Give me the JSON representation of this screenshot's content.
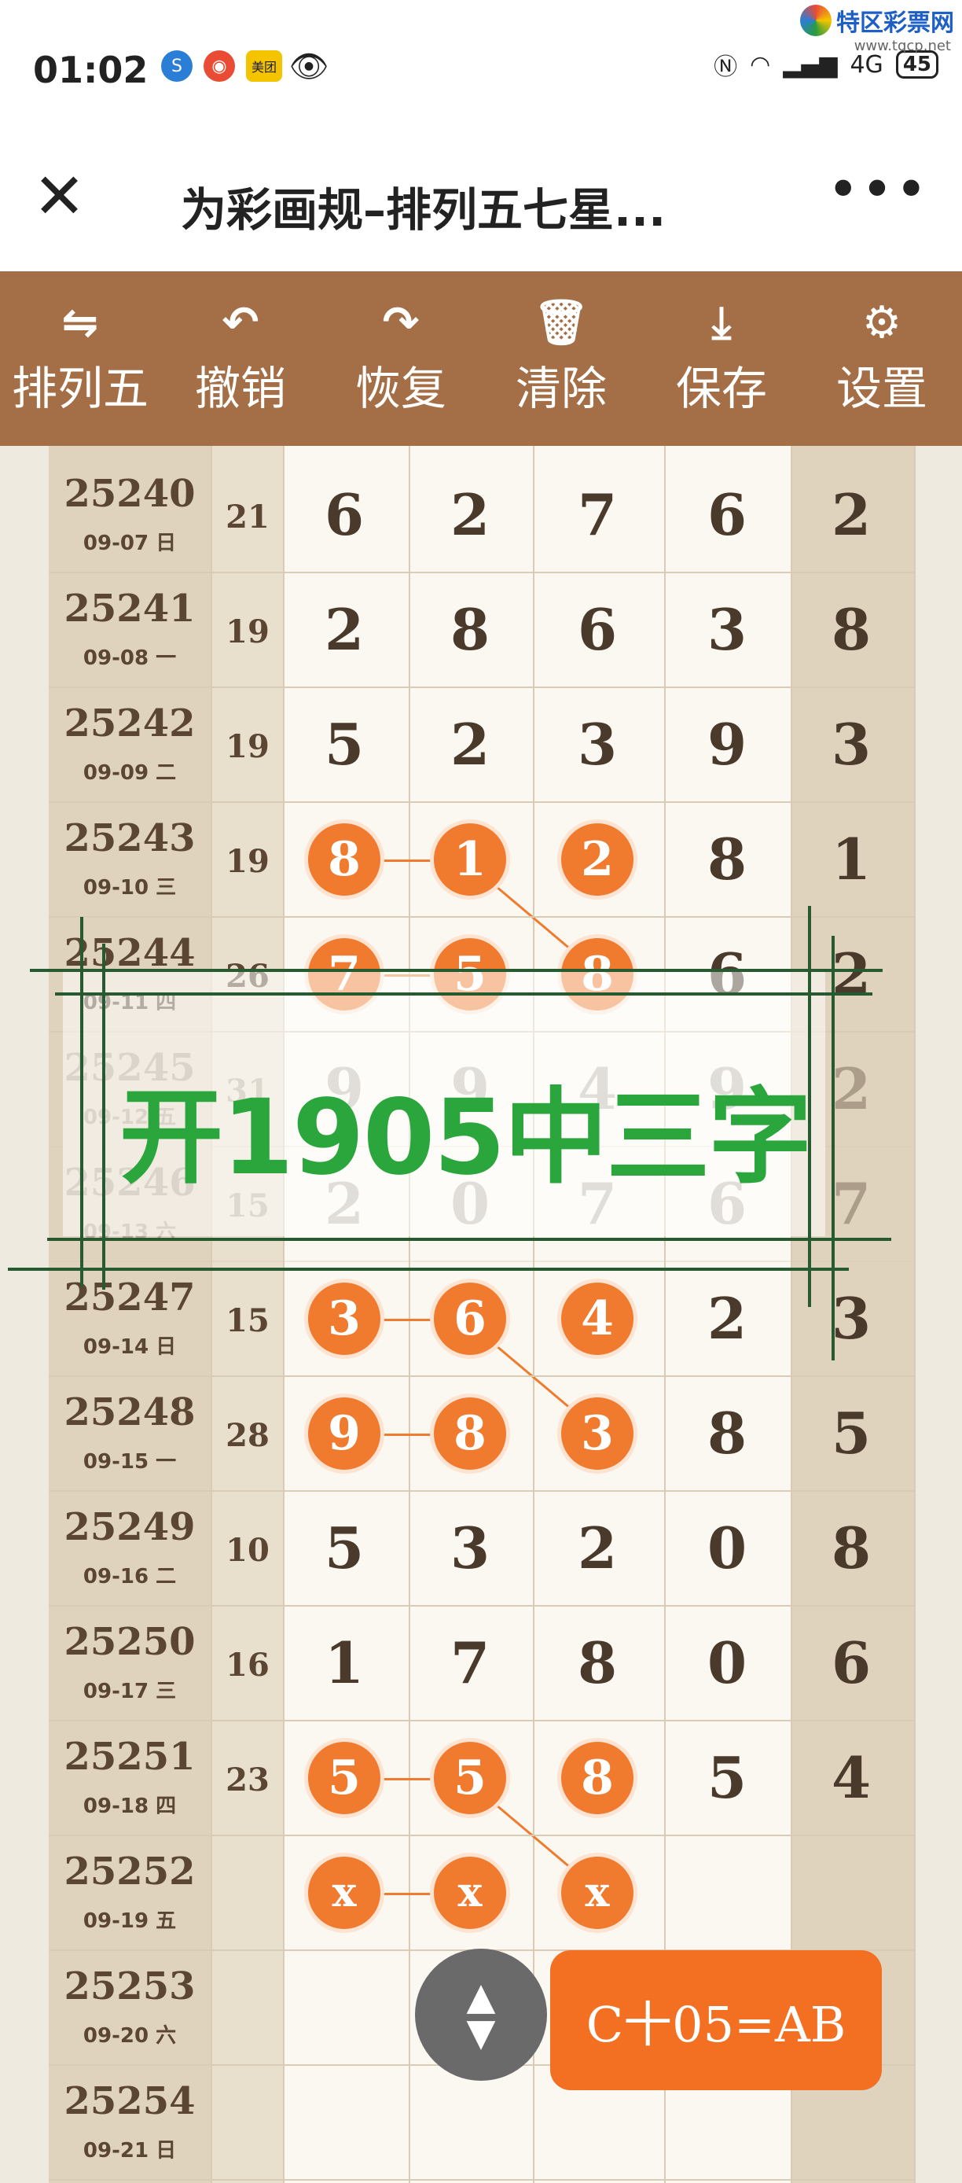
{
  "status": {
    "time": "01:02",
    "battery": "45",
    "network": "4G",
    "watermark": "特区彩票网",
    "watermark_url": "www.tqcp.net",
    "meituan": "美团"
  },
  "titlebar": {
    "close_icon": "close-icon",
    "title": "为彩画规–排列五七星...",
    "more": "•••"
  },
  "toolbar": {
    "items": [
      {
        "icon": "⇋",
        "label": "排列五"
      },
      {
        "icon": "↶",
        "label": "撤销"
      },
      {
        "icon": "↷",
        "label": "恢复"
      },
      {
        "icon": "🗑",
        "label": "清除"
      },
      {
        "icon": "⤓",
        "label": "保存"
      },
      {
        "icon": "⚙",
        "label": "设置"
      }
    ]
  },
  "rows": [
    {
      "issue": "25240",
      "date": "09-07 日",
      "sum": "21",
      "d": [
        "6",
        "2",
        "7",
        "6",
        "2"
      ]
    },
    {
      "issue": "25241",
      "date": "09-08 一",
      "sum": "19",
      "d": [
        "2",
        "8",
        "6",
        "3",
        "8"
      ]
    },
    {
      "issue": "25242",
      "date": "09-09 二",
      "sum": "19",
      "d": [
        "5",
        "2",
        "3",
        "9",
        "3"
      ]
    },
    {
      "issue": "25243",
      "date": "09-10 三",
      "sum": "19",
      "d": [
        "8",
        "1",
        "2",
        "8",
        "1"
      ]
    },
    {
      "issue": "25244",
      "date": "09-11 四",
      "sum": "26",
      "d": [
        "7",
        "5",
        "8",
        "6",
        "2"
      ]
    },
    {
      "issue": "25245",
      "date": "09-12 五",
      "sum": "31",
      "d": [
        "9",
        "9",
        "4",
        "9",
        "2"
      ]
    },
    {
      "issue": "25246",
      "date": "09-13 六",
      "sum": "15",
      "d": [
        "2",
        "0",
        "7",
        "6",
        "7"
      ]
    },
    {
      "issue": "25247",
      "date": "09-14 日",
      "sum": "15",
      "d": [
        "3",
        "6",
        "4",
        "2",
        "3"
      ]
    },
    {
      "issue": "25248",
      "date": "09-15 一",
      "sum": "28",
      "d": [
        "9",
        "8",
        "3",
        "8",
        "5"
      ]
    },
    {
      "issue": "25249",
      "date": "09-16 二",
      "sum": "10",
      "d": [
        "5",
        "3",
        "2",
        "0",
        "8"
      ]
    },
    {
      "issue": "25250",
      "date": "09-17 三",
      "sum": "16",
      "d": [
        "1",
        "7",
        "8",
        "0",
        "6"
      ]
    },
    {
      "issue": "25251",
      "date": "09-18 四",
      "sum": "23",
      "d": [
        "5",
        "5",
        "8",
        "5",
        "4"
      ]
    },
    {
      "issue": "25252",
      "date": "09-19 五",
      "sum": "",
      "d": [
        "x",
        "x",
        "x",
        "",
        ""
      ]
    },
    {
      "issue": "25253",
      "date": "09-20 六",
      "sum": "",
      "d": [
        "",
        "",
        "",
        "",
        ""
      ]
    },
    {
      "issue": "25254",
      "date": "09-21 日",
      "sum": "",
      "d": [
        "",
        "",
        "",
        "",
        ""
      ]
    }
  ],
  "overlay": {
    "text": "开1905中三字"
  },
  "formula": {
    "text": "C十05=AB"
  },
  "fab": {
    "up": "▲",
    "down": "▼"
  },
  "colors": {
    "ball": "#f07a2d",
    "toolbar": "#a46f47",
    "overlay_text": "#2aa63c"
  }
}
